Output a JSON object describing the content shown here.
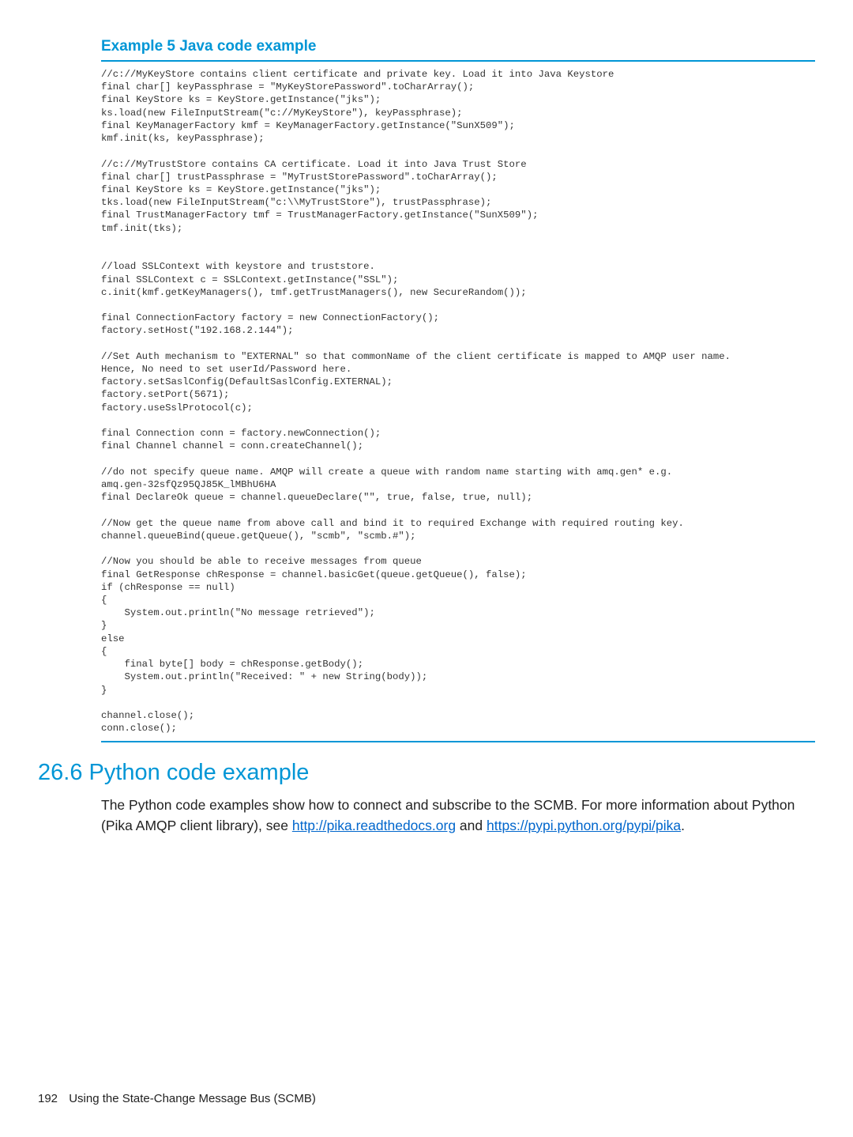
{
  "example": {
    "title": "Example 5 Java code example",
    "code": "//c://MyKeyStore contains client certificate and private key. Load it into Java Keystore\nfinal char[] keyPassphrase = \"MyKeyStorePassword\".toCharArray();\nfinal KeyStore ks = KeyStore.getInstance(\"jks\");\nks.load(new FileInputStream(\"c://MyKeyStore\"), keyPassphrase);\nfinal KeyManagerFactory kmf = KeyManagerFactory.getInstance(\"SunX509\");\nkmf.init(ks, keyPassphrase);\n\n//c://MyTrustStore contains CA certificate. Load it into Java Trust Store\nfinal char[] trustPassphrase = \"MyTrustStorePassword\".toCharArray();\nfinal KeyStore ks = KeyStore.getInstance(\"jks\");\ntks.load(new FileInputStream(\"c:\\\\MyTrustStore\"), trustPassphrase);\nfinal TrustManagerFactory tmf = TrustManagerFactory.getInstance(\"SunX509\");\ntmf.init(tks);\n\n\n//load SSLContext with keystore and truststore.\nfinal SSLContext c = SSLContext.getInstance(\"SSL\");\nc.init(kmf.getKeyManagers(), tmf.getTrustManagers(), new SecureRandom());\n\nfinal ConnectionFactory factory = new ConnectionFactory();\nfactory.setHost(\"192.168.2.144\");\n\n//Set Auth mechanism to \"EXTERNAL\" so that commonName of the client certificate is mapped to AMQP user name.\nHence, No need to set userId/Password here.\nfactory.setSaslConfig(DefaultSaslConfig.EXTERNAL);\nfactory.setPort(5671);\nfactory.useSslProtocol(c);\n\nfinal Connection conn = factory.newConnection();\nfinal Channel channel = conn.createChannel();\n\n//do not specify queue name. AMQP will create a queue with random name starting with amq.gen* e.g.\namq.gen-32sfQz95QJ85K_lMBhU6HA\nfinal DeclareOk queue = channel.queueDeclare(\"\", true, false, true, null);\n\n//Now get the queue name from above call and bind it to required Exchange with required routing key.\nchannel.queueBind(queue.getQueue(), \"scmb\", \"scmb.#\");\n\n//Now you should be able to receive messages from queue\nfinal GetResponse chResponse = channel.basicGet(queue.getQueue(), false);\nif (chResponse == null)\n{\n    System.out.println(\"No message retrieved\");\n}\nelse\n{\n    final byte[] body = chResponse.getBody();\n    System.out.println(\"Received: \" + new String(body));\n}\n\nchannel.close();\nconn.close();"
  },
  "section": {
    "heading": "26.6 Python code example",
    "body_pre": "The Python code examples show how to connect and subscribe to the SCMB. For more information about Python (Pika AMQP client library), see ",
    "link1_text": "http://pika.readthedocs.org",
    "body_mid": " and ",
    "link2_text": "https://pypi.python.org/pypi/pika",
    "body_post": "."
  },
  "footer": {
    "page": "192",
    "title": "Using the State-Change Message Bus (SCMB)"
  }
}
